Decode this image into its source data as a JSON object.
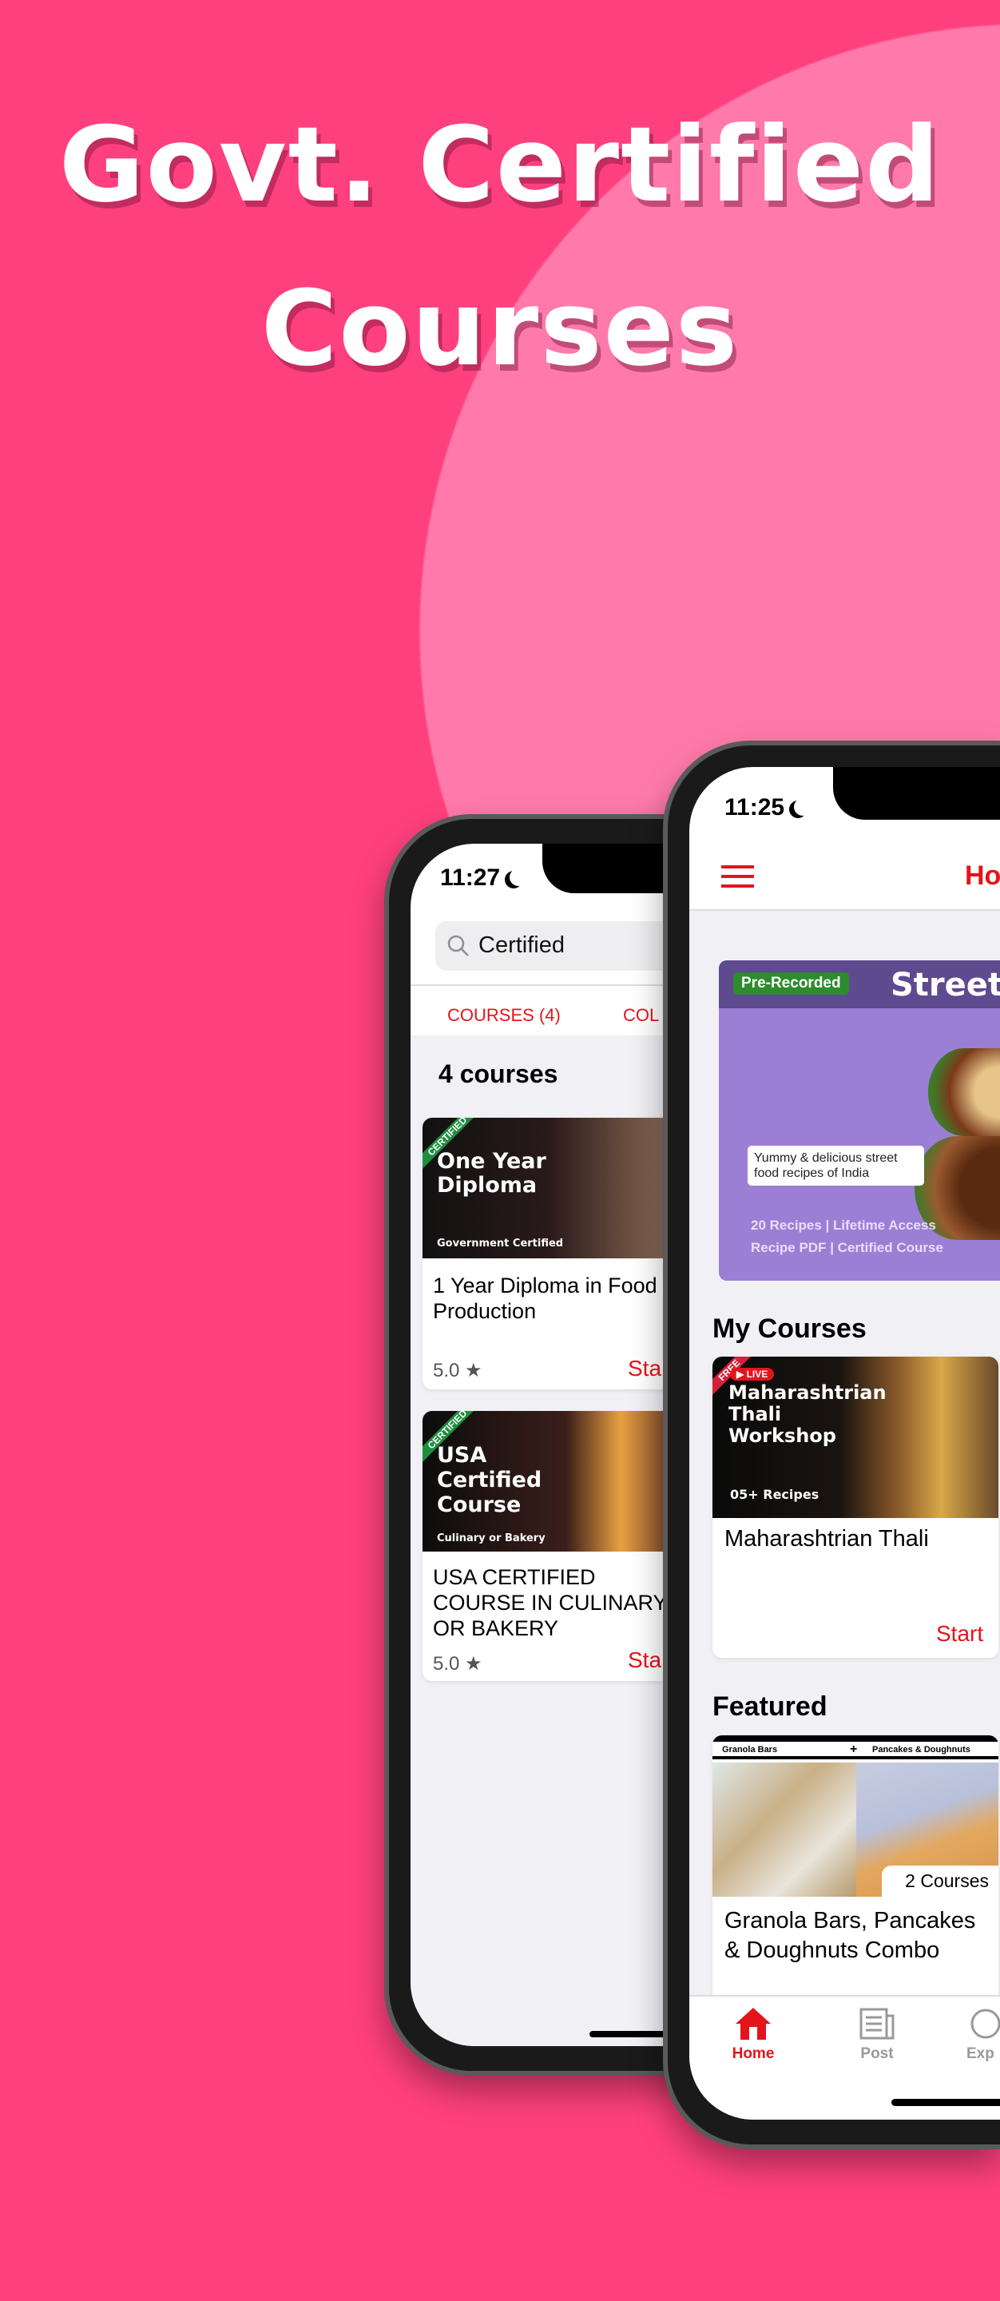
{
  "headline": {
    "line1": "Govt. Certified",
    "line2": "Courses"
  },
  "colors": {
    "background": "#FF407E",
    "circle": "#FF7AAA",
    "accent": "#E4141B",
    "banner": "#9B7FD4"
  },
  "search_phone": {
    "status_time": "11:27",
    "search": {
      "value": "Certified",
      "icon": "search-icon"
    },
    "tabs": [
      {
        "label": "COURSES (4)"
      },
      {
        "label": "COL"
      }
    ],
    "results_heading": "4 courses",
    "courses": [
      {
        "ribbon": "CERTIFIED",
        "image_title": "One Year Diploma",
        "image_subtitle": "Government Certified",
        "title": "1 Year Diploma in Food Production",
        "rating": "5.0",
        "action": "Sta"
      },
      {
        "ribbon": "CERTIFIED",
        "image_title": "USA Certified Course",
        "image_subtitle": "Culinary or Bakery",
        "title": "USA CERTIFIED COURSE IN CULINARY OR BAKERY",
        "rating": "5.0",
        "action": "Sta"
      }
    ]
  },
  "home_phone": {
    "status_time": "11:25",
    "header_title": "Ho",
    "banner": {
      "badge": "Pre-Recorded",
      "title": "Street",
      "note": "Yummy & delicious street food recipes of India",
      "features_line1": "20 Recipes | Lifetime Access",
      "features_line2": "Recipe PDF | Certified Course"
    },
    "my_courses": {
      "heading": "My Courses",
      "card": {
        "ribbon": "FREE",
        "live": "LIVE",
        "image_title": "Maharashtrian Thali Workshop",
        "image_subtitle": "05+ Recipes",
        "title": "Maharashtrian Thali",
        "action": "Start"
      }
    },
    "featured": {
      "heading": "Featured",
      "card": {
        "image_left": "Granola Bars",
        "image_plus": "+",
        "image_right": "Pancakes & Doughnuts",
        "count": "2 Courses",
        "title": "Granola Bars, Pancakes & Doughnuts Combo"
      }
    },
    "tabbar": [
      {
        "label": "Home",
        "icon": "home-icon",
        "active": true
      },
      {
        "label": "Post",
        "icon": "newspaper-icon"
      },
      {
        "label": "Exp",
        "icon": "explore-icon"
      }
    ]
  }
}
